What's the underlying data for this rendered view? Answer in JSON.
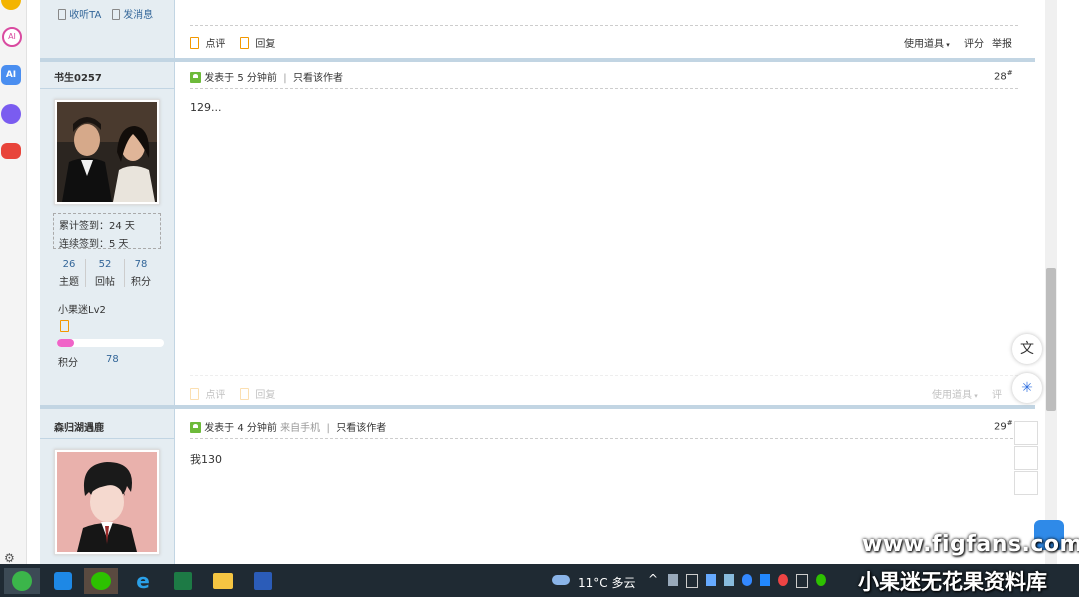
{
  "top_post": {
    "follow_label": "收听TA",
    "message_label": "发消息",
    "rate_label": "点评",
    "reply_label": "回复",
    "use_tool_label": "使用道具",
    "score_label": "评分",
    "report_label": "举报"
  },
  "post28": {
    "username": "书生0257",
    "checkin_total": "累计签到：24 天",
    "checkin_streak": "连续签到：5 天",
    "stats": [
      {
        "value": "26",
        "label": "主题"
      },
      {
        "value": "52",
        "label": "回帖"
      },
      {
        "value": "78",
        "label": "积分"
      }
    ],
    "level": "小果迷Lv2",
    "points_label": "积分",
    "points_value": "78",
    "level_progress": 0.16,
    "posted": "发表于 5 分钟前",
    "only_author": "只看该作者",
    "floor": "28",
    "floor_sup": "#",
    "content": "129...",
    "rate_label": "点评",
    "reply_label": "回复",
    "use_tool_label": "使用道具",
    "score_label": "评"
  },
  "post29": {
    "username": "森归湖遇鹿",
    "posted": "发表于 4 分钟前",
    "source": "来自手机",
    "only_author": "只看该作者",
    "floor": "29",
    "floor_sup": "#",
    "content": "我130"
  },
  "taskbar": {
    "weather": "11°C  多云",
    "apps": [
      "edge-legacy",
      "pinned-app",
      "wechat",
      "ie",
      "excel",
      "files",
      "word"
    ]
  },
  "watermark": {
    "line1": "www.figfans.com",
    "line2": "小果迷无花果资料库"
  },
  "colors": {
    "author_bg": "#e5edf2",
    "border_blue": "#c2d5e3",
    "link_blue": "#336699",
    "level_bar": "#f064c8",
    "taskbar": "#1f2a33"
  }
}
